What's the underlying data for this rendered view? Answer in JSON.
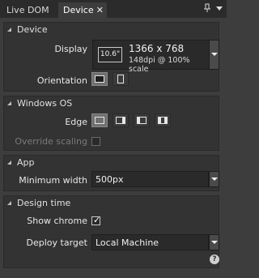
{
  "tabs": [
    {
      "label": "Live DOM",
      "active": false
    },
    {
      "label": "Device",
      "active": true
    }
  ],
  "sections": {
    "device": {
      "title": "Device",
      "display_label": "Display",
      "display_size_badge": "10.6\"",
      "display_resolution": "1366 x 768",
      "display_dpi": "148dpi @ 100% scale",
      "orientation_label": "Orientation"
    },
    "windows_os": {
      "title": "Windows OS",
      "edge_label": "Edge",
      "override_scaling_label": "Override scaling"
    },
    "app": {
      "title": "App",
      "minimum_width_label": "Minimum width",
      "minimum_width_value": "500px"
    },
    "design_time": {
      "title": "Design time",
      "show_chrome_label": "Show chrome",
      "show_chrome_checked": true,
      "deploy_target_label": "Deploy target",
      "deploy_target_value": "Local Machine"
    }
  },
  "help_glyph": "?",
  "colors": {
    "background": "#3d3d3d",
    "section_bg": "#333333",
    "tabbar_bg": "#2b2b2b"
  }
}
